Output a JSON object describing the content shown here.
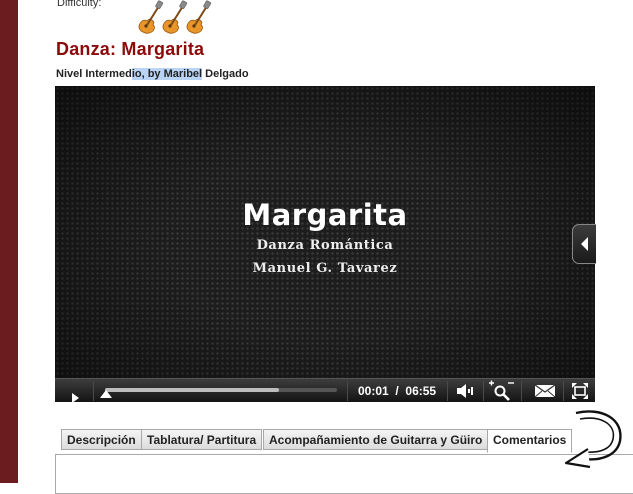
{
  "header": {
    "difficulty_label": "Difficulty:",
    "difficulty_rating": 3,
    "difficulty_icon": "guitar-icon"
  },
  "lesson": {
    "title": "Danza: Margarita",
    "subtitle_parts": [
      "Nivel Intermed",
      "io, by Maribel",
      " Delgado"
    ]
  },
  "video": {
    "title": "Margarita",
    "line1": "Danza Romántica",
    "line2": "Manuel G. Tavarez",
    "current_time": "00:01",
    "time_separator": "/",
    "duration": "06:55",
    "progress": 0.0024,
    "buffered_fraction": 0.75,
    "icons": [
      "play-icon",
      "volume-icon",
      "zoom-icon",
      "email-icon",
      "fullscreen-icon",
      "side-panel-arrow-icon"
    ]
  },
  "tabs": [
    {
      "label": "Descripción",
      "active": false
    },
    {
      "label": "Tablatura/ Partitura",
      "active": false
    },
    {
      "label": "Acompañamiento de Guitarra y Güiro",
      "active": false
    },
    {
      "label": "Comentarios",
      "active": true
    }
  ],
  "colors": {
    "title": "#8b0a0a",
    "sidebar": "#6b1c1f",
    "highlight": "#b9d4f5"
  }
}
